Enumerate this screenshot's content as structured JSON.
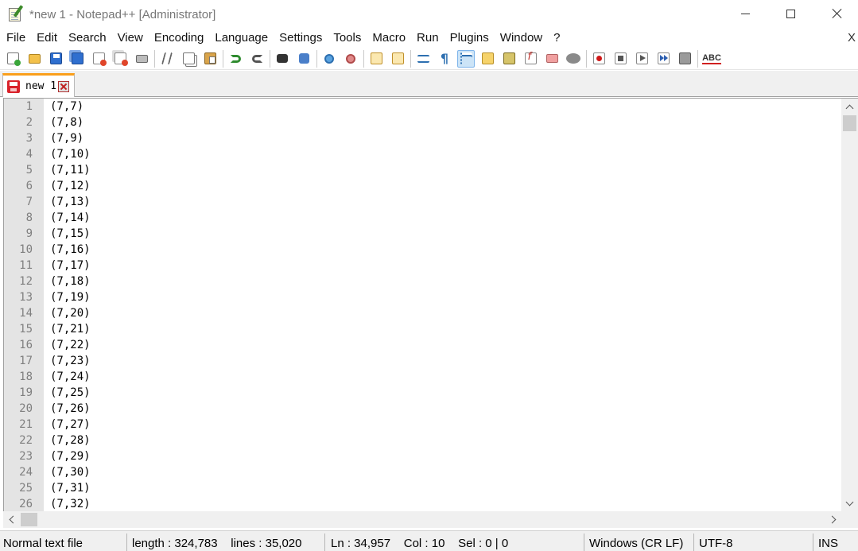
{
  "window": {
    "title": "*new 1 - Notepad++ [Administrator]"
  },
  "menubar": {
    "items": [
      "File",
      "Edit",
      "Search",
      "View",
      "Encoding",
      "Language",
      "Settings",
      "Tools",
      "Macro",
      "Run",
      "Plugins",
      "Window",
      "?"
    ],
    "close_label": "X"
  },
  "toolbar": {
    "icons": [
      "new-file-icon",
      "open-file-icon",
      "save-icon",
      "save-all-icon",
      "close-icon",
      "close-all-icon",
      "print-icon",
      "cut-icon",
      "copy-icon",
      "paste-icon",
      "undo-icon",
      "redo-icon",
      "find-icon",
      "replace-icon",
      "zoom-in-icon",
      "zoom-out-icon",
      "sync-vertical-icon",
      "sync-horizontal-icon",
      "word-wrap-icon",
      "show-all-characters-icon",
      "indent-guide-icon",
      "user-defined-language-icon",
      "document-map-icon",
      "function-list-icon",
      "folder-as-workspace-icon",
      "monitoring-icon",
      "record-macro-icon",
      "stop-recording-icon",
      "playback-macro-icon",
      "run-macro-multiple-icon",
      "save-macro-icon",
      "spell-check-icon"
    ],
    "spell_check_label": "ABC"
  },
  "tabs": [
    {
      "label": "new 1",
      "modified": true
    }
  ],
  "editor": {
    "lines": [
      {
        "n": "1",
        "text": "(7,7)"
      },
      {
        "n": "2",
        "text": "(7,8)"
      },
      {
        "n": "3",
        "text": "(7,9)"
      },
      {
        "n": "4",
        "text": "(7,10)"
      },
      {
        "n": "5",
        "text": "(7,11)"
      },
      {
        "n": "6",
        "text": "(7,12)"
      },
      {
        "n": "7",
        "text": "(7,13)"
      },
      {
        "n": "8",
        "text": "(7,14)"
      },
      {
        "n": "9",
        "text": "(7,15)"
      },
      {
        "n": "10",
        "text": "(7,16)"
      },
      {
        "n": "11",
        "text": "(7,17)"
      },
      {
        "n": "12",
        "text": "(7,18)"
      },
      {
        "n": "13",
        "text": "(7,19)"
      },
      {
        "n": "14",
        "text": "(7,20)"
      },
      {
        "n": "15",
        "text": "(7,21)"
      },
      {
        "n": "16",
        "text": "(7,22)"
      },
      {
        "n": "17",
        "text": "(7,23)"
      },
      {
        "n": "18",
        "text": "(7,24)"
      },
      {
        "n": "19",
        "text": "(7,25)"
      },
      {
        "n": "20",
        "text": "(7,26)"
      },
      {
        "n": "21",
        "text": "(7,27)"
      },
      {
        "n": "22",
        "text": "(7,28)"
      },
      {
        "n": "23",
        "text": "(7,29)"
      },
      {
        "n": "24",
        "text": "(7,30)"
      },
      {
        "n": "25",
        "text": "(7,31)"
      },
      {
        "n": "26",
        "text": "(7,32)"
      }
    ]
  },
  "statusbar": {
    "file_type": "Normal text file",
    "length_lines": "length : 324,783    lines : 35,020",
    "position": "Ln : 34,957    Col : 10    Sel : 0 | 0",
    "eol": "Windows (CR LF)",
    "encoding": "UTF-8",
    "mode": "INS"
  },
  "colors": {
    "tab_accent": "#fa9f1b",
    "gutter_bg": "#e4e4e4",
    "line_number": "#808080"
  }
}
